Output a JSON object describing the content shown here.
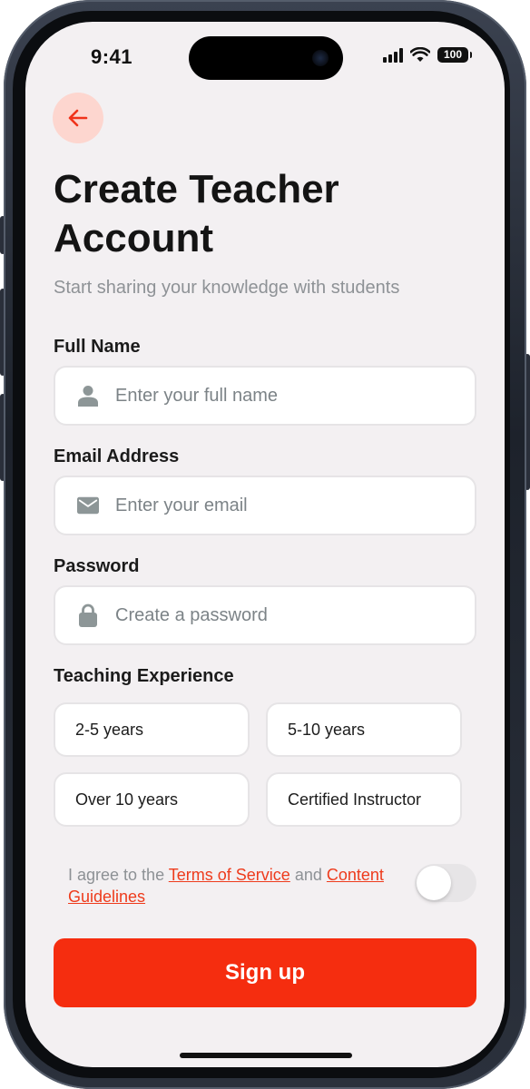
{
  "status_bar": {
    "time": "9:41",
    "battery": "100"
  },
  "header": {
    "title": "Create Teacher Account",
    "subtitle": "Start sharing your knowledge with students"
  },
  "form": {
    "full_name": {
      "label": "Full Name",
      "placeholder": "Enter your full name",
      "icon": "person-icon",
      "value": ""
    },
    "email": {
      "label": "Email Address",
      "placeholder": "Enter your email",
      "icon": "mail-icon",
      "value": ""
    },
    "password": {
      "label": "Password",
      "placeholder": "Create a password",
      "icon": "lock-icon",
      "value": ""
    },
    "experience": {
      "label": "Teaching Experience",
      "options": [
        "2-5 years",
        "5-10 years",
        "Over 10 years",
        "Certified Instructor"
      ]
    }
  },
  "agreement": {
    "prefix": "I agree to the",
    "terms_link": "Terms of Service",
    "conjunction": "and",
    "guidelines_link": "Content Guidelines",
    "toggle_on": false
  },
  "actions": {
    "signup_label": "Sign up"
  },
  "colors": {
    "accent": "#f52d0f",
    "back_button_bg": "#fdd6cf",
    "screen_bg": "#f3f0f2",
    "link": "#ee3b1c"
  }
}
